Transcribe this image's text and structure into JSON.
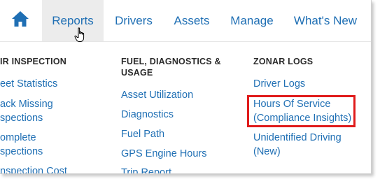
{
  "nav": {
    "home_icon": "home-icon",
    "tabs": [
      {
        "label": "Reports"
      },
      {
        "label": "Drivers"
      },
      {
        "label": "Assets"
      },
      {
        "label": "Manage"
      },
      {
        "label": "What's New"
      }
    ]
  },
  "menu": {
    "col1": {
      "title": "IR INSPECTION",
      "links": [
        "eet Statistics",
        "ack Missing",
        "spections",
        "omplete",
        "spections",
        "nspection Cost"
      ]
    },
    "col2": {
      "title_line1": "FUEL, DIAGNOSTICS &",
      "title_line2": "USAGE",
      "links": [
        "Asset Utilization",
        "Diagnostics",
        "Fuel Path",
        "GPS Engine Hours",
        "Trip Report"
      ]
    },
    "col3": {
      "title": "ZONAR LOGS",
      "links": [
        "Driver Logs",
        "Hours Of Service",
        "(Compliance Insights)",
        "Unidentified Driving",
        "(New)"
      ]
    }
  },
  "colors": {
    "link": "#1f6fb4",
    "highlight": "#e01b1b",
    "active_tab_bg": "#ececec"
  }
}
